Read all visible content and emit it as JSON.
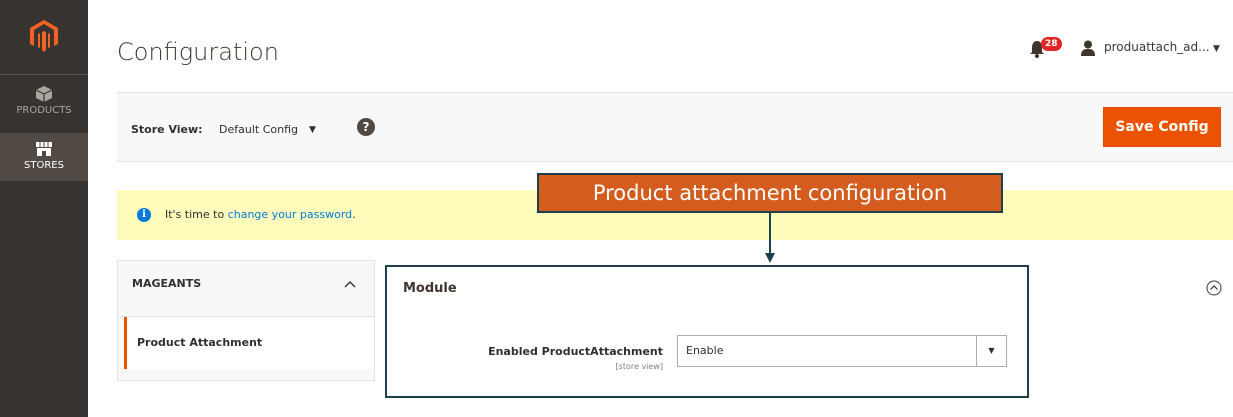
{
  "nav": {
    "items": [
      {
        "label": "PRODUCTS",
        "icon": "cube-icon"
      },
      {
        "label": "STORES",
        "icon": "store-icon"
      }
    ]
  },
  "header": {
    "title": "Configuration",
    "notifications_count": "28",
    "user_name": "produattach_ad..."
  },
  "store_bar": {
    "label": "Store View:",
    "value": "Default Config",
    "save_label": "Save Config"
  },
  "notice": {
    "prefix": "It's time to ",
    "link": "change your password",
    "suffix": "."
  },
  "annotation": {
    "text": "Product attachment configuration"
  },
  "tabs": {
    "group": "MAGEANTS",
    "items": [
      {
        "label": "Product Attachment"
      }
    ]
  },
  "module": {
    "title": "Module",
    "field_label": "Enabled ProductAttachment",
    "field_scope": "[store view]",
    "field_value": "Enable"
  },
  "colors": {
    "accent": "#eb5202",
    "nav_bg": "#373330",
    "annotation_bg": "#d35c1e",
    "annotation_border": "#1d3f4c"
  }
}
